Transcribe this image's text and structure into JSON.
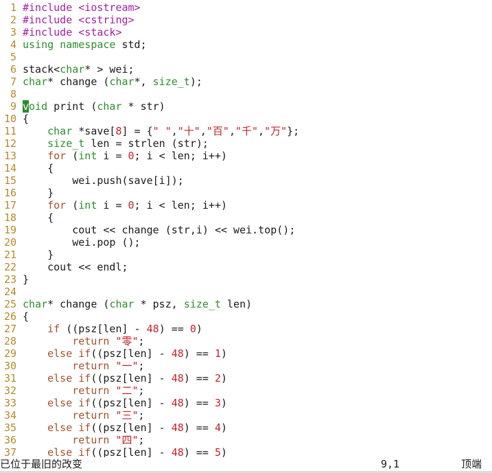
{
  "colors": {
    "line_number": "#b5892b",
    "preprocessor": "#a31ea3",
    "type": "#2e8b2e",
    "keyword": "#a0522d",
    "string": "#c0232b",
    "number": "#c0232b",
    "cursor": "#2b8a2b"
  },
  "editor": {
    "lines": [
      {
        "n": "1",
        "tokens": [
          {
            "t": "#include <iostream>",
            "c": "prep"
          }
        ]
      },
      {
        "n": "2",
        "tokens": [
          {
            "t": "#include <cstring>",
            "c": "prep"
          }
        ]
      },
      {
        "n": "3",
        "tokens": [
          {
            "t": "#include <stack>",
            "c": "prep"
          }
        ]
      },
      {
        "n": "4",
        "tokens": [
          {
            "t": "using",
            "c": "type"
          },
          {
            "t": " ",
            "c": "plain"
          },
          {
            "t": "namespace",
            "c": "type"
          },
          {
            "t": " std;",
            "c": "plain"
          }
        ]
      },
      {
        "n": "5",
        "tokens": []
      },
      {
        "n": "6",
        "tokens": [
          {
            "t": "stack<",
            "c": "plain"
          },
          {
            "t": "char",
            "c": "type"
          },
          {
            "t": "* > wei;",
            "c": "plain"
          }
        ]
      },
      {
        "n": "7",
        "tokens": [
          {
            "t": "char",
            "c": "type"
          },
          {
            "t": "* change (",
            "c": "plain"
          },
          {
            "t": "char",
            "c": "type"
          },
          {
            "t": "*, ",
            "c": "plain"
          },
          {
            "t": "size_t",
            "c": "type"
          },
          {
            "t": ");",
            "c": "plain"
          }
        ]
      },
      {
        "n": "8",
        "tokens": []
      },
      {
        "n": "9",
        "tokens": [
          {
            "t": "v",
            "c": "cursor"
          },
          {
            "t": "oid",
            "c": "type"
          },
          {
            "t": " print (",
            "c": "plain"
          },
          {
            "t": "char",
            "c": "type"
          },
          {
            "t": " * str)",
            "c": "plain"
          }
        ]
      },
      {
        "n": "10",
        "tokens": [
          {
            "t": "{",
            "c": "plain"
          }
        ]
      },
      {
        "n": "11",
        "tokens": [
          {
            "t": "    ",
            "c": "plain"
          },
          {
            "t": "char",
            "c": "type"
          },
          {
            "t": " *save[",
            "c": "plain"
          },
          {
            "t": "8",
            "c": "num"
          },
          {
            "t": "] = {",
            "c": "plain"
          },
          {
            "t": "\" \"",
            "c": "str"
          },
          {
            "t": ",",
            "c": "plain"
          },
          {
            "t": "\"十\"",
            "c": "str"
          },
          {
            "t": ",",
            "c": "plain"
          },
          {
            "t": "\"百\"",
            "c": "str"
          },
          {
            "t": ",",
            "c": "plain"
          },
          {
            "t": "\"千\"",
            "c": "str"
          },
          {
            "t": ",",
            "c": "plain"
          },
          {
            "t": "\"万\"",
            "c": "str"
          },
          {
            "t": "};",
            "c": "plain"
          }
        ]
      },
      {
        "n": "12",
        "tokens": [
          {
            "t": "    ",
            "c": "plain"
          },
          {
            "t": "size_t",
            "c": "type"
          },
          {
            "t": " len = strlen (str);",
            "c": "plain"
          }
        ]
      },
      {
        "n": "13",
        "tokens": [
          {
            "t": "    ",
            "c": "plain"
          },
          {
            "t": "for",
            "c": "kw"
          },
          {
            "t": " (",
            "c": "plain"
          },
          {
            "t": "int",
            "c": "type"
          },
          {
            "t": " i = ",
            "c": "plain"
          },
          {
            "t": "0",
            "c": "num"
          },
          {
            "t": "; i < len; i++)",
            "c": "plain"
          }
        ]
      },
      {
        "n": "14",
        "tokens": [
          {
            "t": "    {",
            "c": "plain"
          }
        ]
      },
      {
        "n": "15",
        "tokens": [
          {
            "t": "        wei.push(save[i]);",
            "c": "plain"
          }
        ]
      },
      {
        "n": "16",
        "tokens": [
          {
            "t": "    }",
            "c": "plain"
          }
        ]
      },
      {
        "n": "17",
        "tokens": [
          {
            "t": "    ",
            "c": "plain"
          },
          {
            "t": "for",
            "c": "kw"
          },
          {
            "t": " (",
            "c": "plain"
          },
          {
            "t": "int",
            "c": "type"
          },
          {
            "t": " i = ",
            "c": "plain"
          },
          {
            "t": "0",
            "c": "num"
          },
          {
            "t": "; i < len; i++)",
            "c": "plain"
          }
        ]
      },
      {
        "n": "18",
        "tokens": [
          {
            "t": "    {",
            "c": "plain"
          }
        ]
      },
      {
        "n": "19",
        "tokens": [
          {
            "t": "        cout << change (str,i) << wei.top();",
            "c": "plain"
          }
        ]
      },
      {
        "n": "20",
        "tokens": [
          {
            "t": "        wei.pop ();",
            "c": "plain"
          }
        ]
      },
      {
        "n": "21",
        "tokens": [
          {
            "t": "    }",
            "c": "plain"
          }
        ]
      },
      {
        "n": "22",
        "tokens": [
          {
            "t": "    cout << endl;",
            "c": "plain"
          }
        ]
      },
      {
        "n": "23",
        "tokens": [
          {
            "t": "}",
            "c": "plain"
          }
        ]
      },
      {
        "n": "24",
        "tokens": []
      },
      {
        "n": "25",
        "tokens": [
          {
            "t": "char",
            "c": "type"
          },
          {
            "t": "* change (",
            "c": "plain"
          },
          {
            "t": "char",
            "c": "type"
          },
          {
            "t": " * psz, ",
            "c": "plain"
          },
          {
            "t": "size_t",
            "c": "type"
          },
          {
            "t": " len)",
            "c": "plain"
          }
        ]
      },
      {
        "n": "26",
        "tokens": [
          {
            "t": "{",
            "c": "plain"
          }
        ]
      },
      {
        "n": "27",
        "tokens": [
          {
            "t": "    ",
            "c": "plain"
          },
          {
            "t": "if",
            "c": "kw"
          },
          {
            "t": " ((psz[len] - ",
            "c": "plain"
          },
          {
            "t": "48",
            "c": "num"
          },
          {
            "t": ") == ",
            "c": "plain"
          },
          {
            "t": "0",
            "c": "num"
          },
          {
            "t": ")",
            "c": "plain"
          }
        ]
      },
      {
        "n": "28",
        "tokens": [
          {
            "t": "        ",
            "c": "plain"
          },
          {
            "t": "return",
            "c": "kw"
          },
          {
            "t": " ",
            "c": "plain"
          },
          {
            "t": "\"零\"",
            "c": "str"
          },
          {
            "t": ";",
            "c": "plain"
          }
        ]
      },
      {
        "n": "29",
        "tokens": [
          {
            "t": "    ",
            "c": "plain"
          },
          {
            "t": "else",
            "c": "kw"
          },
          {
            "t": " ",
            "c": "plain"
          },
          {
            "t": "if",
            "c": "kw"
          },
          {
            "t": "((psz[len] - ",
            "c": "plain"
          },
          {
            "t": "48",
            "c": "num"
          },
          {
            "t": ") == ",
            "c": "plain"
          },
          {
            "t": "1",
            "c": "num"
          },
          {
            "t": ")",
            "c": "plain"
          }
        ]
      },
      {
        "n": "30",
        "tokens": [
          {
            "t": "        ",
            "c": "plain"
          },
          {
            "t": "return",
            "c": "kw"
          },
          {
            "t": " ",
            "c": "plain"
          },
          {
            "t": "\"一\"",
            "c": "str"
          },
          {
            "t": ";",
            "c": "plain"
          }
        ]
      },
      {
        "n": "31",
        "tokens": [
          {
            "t": "    ",
            "c": "plain"
          },
          {
            "t": "else",
            "c": "kw"
          },
          {
            "t": " ",
            "c": "plain"
          },
          {
            "t": "if",
            "c": "kw"
          },
          {
            "t": "((psz[len] - ",
            "c": "plain"
          },
          {
            "t": "48",
            "c": "num"
          },
          {
            "t": ") == ",
            "c": "plain"
          },
          {
            "t": "2",
            "c": "num"
          },
          {
            "t": ")",
            "c": "plain"
          }
        ]
      },
      {
        "n": "32",
        "tokens": [
          {
            "t": "        ",
            "c": "plain"
          },
          {
            "t": "return",
            "c": "kw"
          },
          {
            "t": " ",
            "c": "plain"
          },
          {
            "t": "\"二\"",
            "c": "str"
          },
          {
            "t": ";",
            "c": "plain"
          }
        ]
      },
      {
        "n": "33",
        "tokens": [
          {
            "t": "    ",
            "c": "plain"
          },
          {
            "t": "else",
            "c": "kw"
          },
          {
            "t": " ",
            "c": "plain"
          },
          {
            "t": "if",
            "c": "kw"
          },
          {
            "t": "((psz[len] - ",
            "c": "plain"
          },
          {
            "t": "48",
            "c": "num"
          },
          {
            "t": ") == ",
            "c": "plain"
          },
          {
            "t": "3",
            "c": "num"
          },
          {
            "t": ")",
            "c": "plain"
          }
        ]
      },
      {
        "n": "34",
        "tokens": [
          {
            "t": "        ",
            "c": "plain"
          },
          {
            "t": "return",
            "c": "kw"
          },
          {
            "t": " ",
            "c": "plain"
          },
          {
            "t": "\"三\"",
            "c": "str"
          },
          {
            "t": ";",
            "c": "plain"
          }
        ]
      },
      {
        "n": "35",
        "tokens": [
          {
            "t": "    ",
            "c": "plain"
          },
          {
            "t": "else",
            "c": "kw"
          },
          {
            "t": " ",
            "c": "plain"
          },
          {
            "t": "if",
            "c": "kw"
          },
          {
            "t": "((psz[len] - ",
            "c": "plain"
          },
          {
            "t": "48",
            "c": "num"
          },
          {
            "t": ") == ",
            "c": "plain"
          },
          {
            "t": "4",
            "c": "num"
          },
          {
            "t": ")",
            "c": "plain"
          }
        ]
      },
      {
        "n": "36",
        "tokens": [
          {
            "t": "        ",
            "c": "plain"
          },
          {
            "t": "return",
            "c": "kw"
          },
          {
            "t": " ",
            "c": "plain"
          },
          {
            "t": "\"四\"",
            "c": "str"
          },
          {
            "t": ";",
            "c": "plain"
          }
        ]
      },
      {
        "n": "37",
        "tokens": [
          {
            "t": "    ",
            "c": "plain"
          },
          {
            "t": "else",
            "c": "kw"
          },
          {
            "t": " ",
            "c": "plain"
          },
          {
            "t": "if",
            "c": "kw"
          },
          {
            "t": "((psz[len] - ",
            "c": "plain"
          },
          {
            "t": "48",
            "c": "num"
          },
          {
            "t": ") == ",
            "c": "plain"
          },
          {
            "t": "5",
            "c": "num"
          },
          {
            "t": ")",
            "c": "plain"
          }
        ]
      }
    ]
  },
  "statusbar": {
    "message": "已位于最旧的改变",
    "cursor_position": "9,1",
    "scroll_position": "顶端"
  }
}
